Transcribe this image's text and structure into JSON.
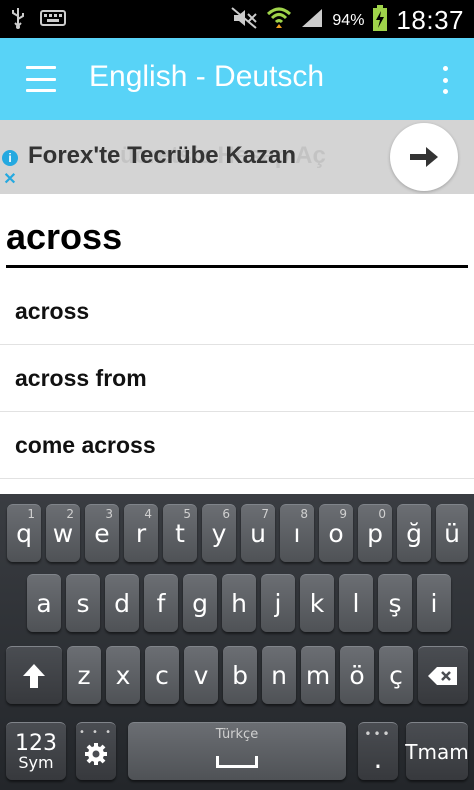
{
  "status_bar": {
    "battery_percent": "94%",
    "time": "18:37",
    "icons": [
      "usb-icon",
      "keyboard-icon",
      "mute-icon",
      "wifi-icon",
      "signal-icon",
      "battery-charging-icon"
    ]
  },
  "app_bar": {
    "title": "English - Deutsch",
    "color": "#58d3f7"
  },
  "ad": {
    "text": "Forex'te Tecrübe Kazan",
    "ghost_text": "ücretsiz Hesap Aç",
    "info_icon": "i",
    "close_icon": "✕"
  },
  "search": {
    "query": "across"
  },
  "results": [
    {
      "label": "across"
    },
    {
      "label": "across from"
    },
    {
      "label": "come across"
    }
  ],
  "keyboard": {
    "row1": [
      {
        "label": "q",
        "hint": "1"
      },
      {
        "label": "w",
        "hint": "2"
      },
      {
        "label": "e",
        "hint": "3"
      },
      {
        "label": "r",
        "hint": "4"
      },
      {
        "label": "t",
        "hint": "5"
      },
      {
        "label": "y",
        "hint": "6"
      },
      {
        "label": "u",
        "hint": "7"
      },
      {
        "label": "ı",
        "hint": "8"
      },
      {
        "label": "o",
        "hint": "9"
      },
      {
        "label": "p",
        "hint": "0"
      },
      {
        "label": "ğ",
        "hint": ""
      },
      {
        "label": "ü",
        "hint": ""
      }
    ],
    "row2": [
      "a",
      "s",
      "d",
      "f",
      "g",
      "h",
      "j",
      "k",
      "l",
      "ş",
      "i"
    ],
    "row3": [
      "z",
      "x",
      "c",
      "v",
      "b",
      "n",
      "m",
      "ö",
      "ç"
    ],
    "sym_key": {
      "line1": "123",
      "line2": "Sym"
    },
    "space_label": "Türkçe",
    "dots_label": "•••",
    "enter_label": "Tmam"
  }
}
